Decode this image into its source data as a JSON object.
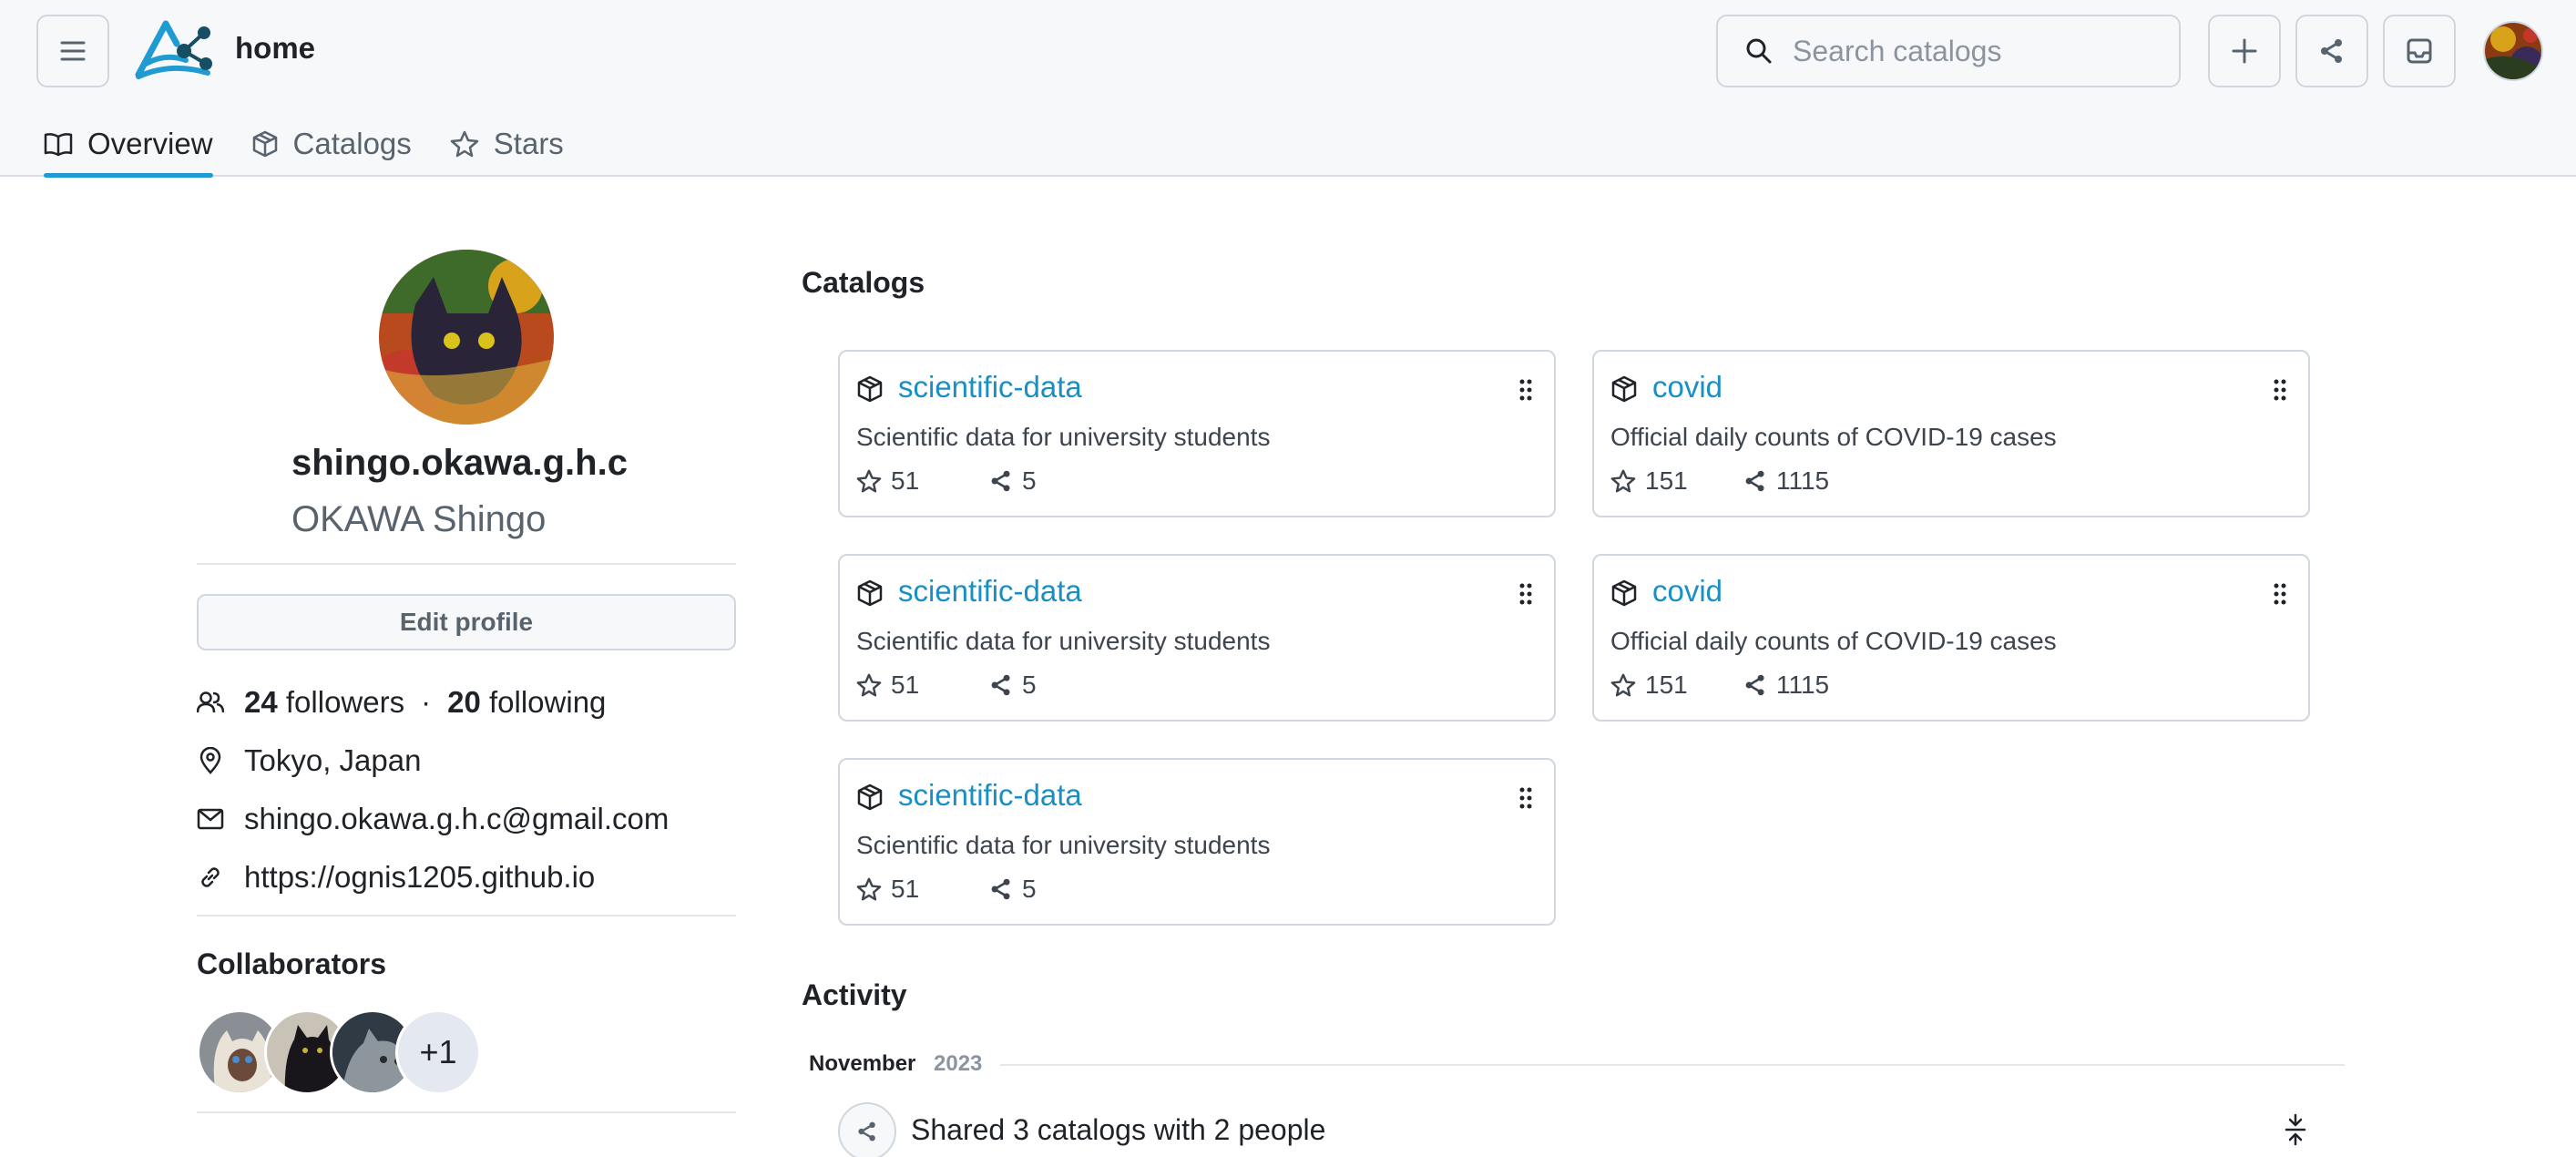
{
  "header": {
    "title": "home",
    "search_placeholder": "Search catalogs",
    "icons": [
      "menu-icon",
      "plus-icon",
      "share-icon",
      "inbox-icon"
    ],
    "accent_color": "#1f9bd1"
  },
  "tabs": [
    {
      "label": "Overview",
      "icon": "book-icon",
      "active": true
    },
    {
      "label": "Catalogs",
      "icon": "package-icon",
      "active": false
    },
    {
      "label": "Stars",
      "icon": "star-icon",
      "active": false
    }
  ],
  "profile": {
    "username": "shingo.okawa.g.h.c",
    "fullname": "OKAWA Shingo",
    "edit_label": "Edit profile",
    "followers_count": "24",
    "followers_label": "followers",
    "dot": "·",
    "following_count": "20",
    "following_label": "following",
    "location": "Tokyo, Japan",
    "email": "shingo.okawa.g.h.c@gmail.com",
    "website": "https://ognis1205.github.io"
  },
  "collaborators": {
    "title": "Collaborators",
    "more": "+1"
  },
  "catalogs": {
    "title": "Catalogs",
    "items": [
      {
        "name": "scientific-data",
        "description": "Scientific data for university students",
        "stars": "51",
        "shares": "5"
      },
      {
        "name": "covid",
        "description": "Official daily counts of COVID-19 cases",
        "stars": "151",
        "shares": "1115"
      },
      {
        "name": "scientific-data",
        "description": "Scientific data for university students",
        "stars": "51",
        "shares": "5"
      },
      {
        "name": "covid",
        "description": "Official daily counts of COVID-19 cases",
        "stars": "151",
        "shares": "1115"
      },
      {
        "name": "scientific-data",
        "description": "Scientific data for university students",
        "stars": "51",
        "shares": "5"
      }
    ]
  },
  "activity": {
    "title": "Activity",
    "month": "November",
    "year": "2023",
    "item_text": "Shared 3 catalogs with 2 people"
  }
}
